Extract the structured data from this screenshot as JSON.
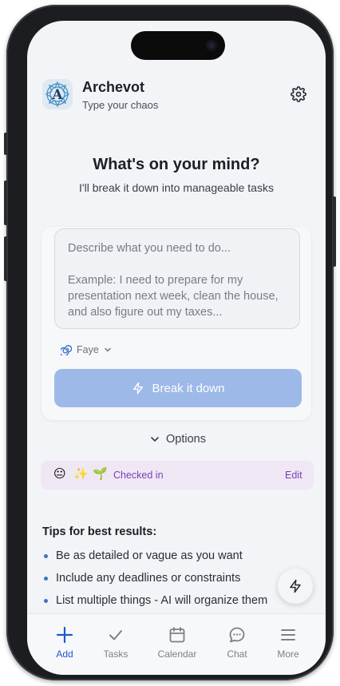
{
  "app": {
    "name": "Archevot",
    "tagline": "Type your chaos",
    "logo_letter": "A"
  },
  "hero": {
    "title": "What's on your mind?",
    "subtitle": "I'll break it down into manageable tasks"
  },
  "composer": {
    "placeholder": "Describe what you need to do...\n\nExample: I need to prepare for my presentation next week, clean the house, and also figure out my taxes...",
    "model": "Faye",
    "submit_label": "Break it down"
  },
  "options_label": "Options",
  "checkin": {
    "emojis": [
      "😐",
      "✨",
      "🌱"
    ],
    "label": "Checked in",
    "edit_label": "Edit"
  },
  "tips": {
    "title": "Tips for best results:",
    "items": [
      "Be as detailed or vague as you want",
      "Include any deadlines or constraints",
      "List multiple things - AI will organize them"
    ]
  },
  "tabs": [
    {
      "label": "Add",
      "icon": "plus-icon",
      "active": true
    },
    {
      "label": "Tasks",
      "icon": "check-icon",
      "active": false
    },
    {
      "label": "Calendar",
      "icon": "calendar-icon",
      "active": false
    },
    {
      "label": "Chat",
      "icon": "chat-bubble-icon",
      "active": false
    },
    {
      "label": "More",
      "icon": "menu-icon",
      "active": false
    }
  ],
  "colors": {
    "accent": "#1f57c8",
    "button": "#9cb9e8",
    "checkin_bg": "#efe8f4",
    "checkin_text": "#7a3fb6",
    "bullet": "#3b73c9"
  }
}
